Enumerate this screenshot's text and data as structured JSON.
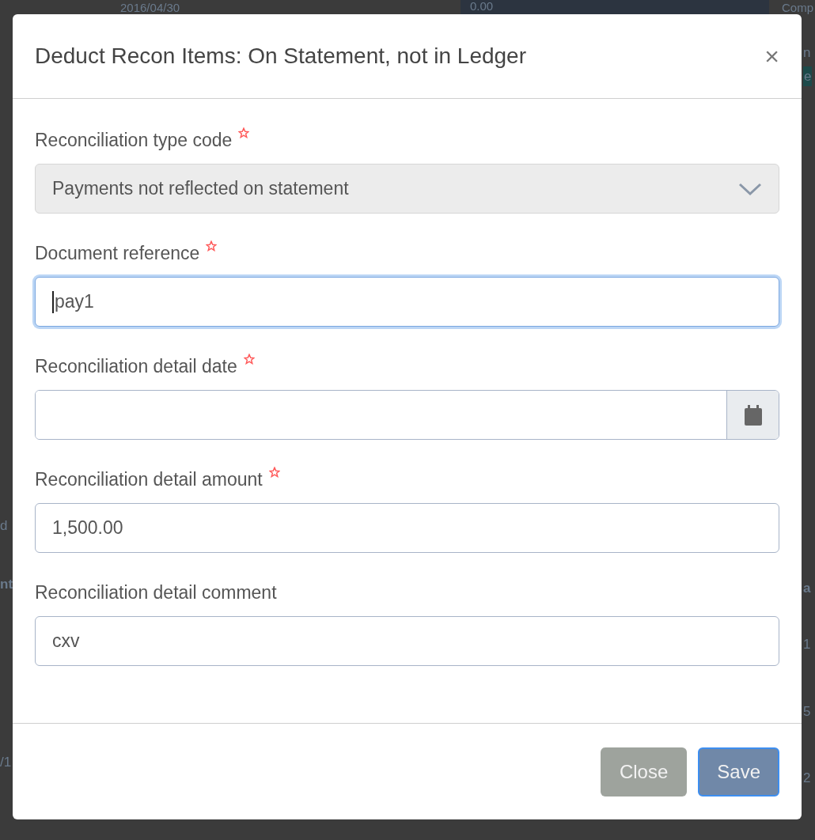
{
  "background": {
    "top_row": [
      "2016/04/30",
      "0.00",
      "Comp"
    ],
    "left_column": [
      "d",
      "nt",
      "/1"
    ],
    "right_column": [
      "n",
      "e",
      "a",
      "1",
      "5",
      "2"
    ]
  },
  "dialog": {
    "title": "Deduct Recon Items: On Statement, not in Ledger",
    "close_icon": "×",
    "fields": [
      {
        "kind": "select",
        "label": "Reconciliation type code",
        "required": true,
        "disabled": true,
        "value": "Payments not reflected on statement"
      },
      {
        "kind": "text",
        "label": "Document reference",
        "required": true,
        "focused": true,
        "value": "pay1"
      },
      {
        "kind": "date",
        "label": "Reconciliation detail date",
        "required": true,
        "focused": false
      },
      {
        "kind": "text",
        "label": "Reconciliation detail amount",
        "required": true,
        "focused": false,
        "value": "1,500.00"
      },
      {
        "kind": "text",
        "label": "Reconciliation detail comment",
        "focused": false,
        "value": "cxv"
      }
    ],
    "buttons": [
      {
        "label": "Close",
        "kind": "secondary",
        "focused": false
      },
      {
        "label": "Save",
        "kind": "primary",
        "focused": true
      }
    ]
  }
}
